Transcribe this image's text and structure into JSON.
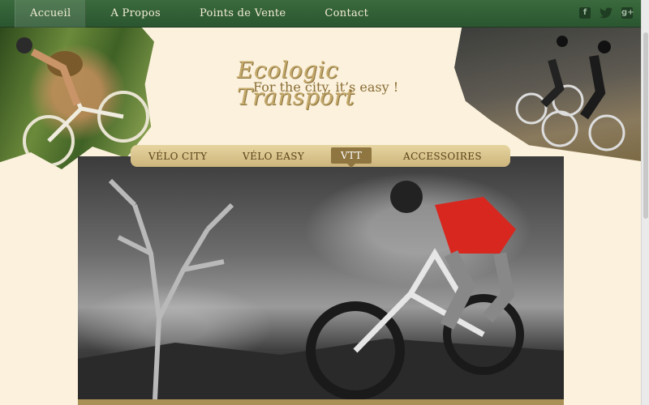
{
  "topnav": {
    "items": [
      {
        "label": "Accueil",
        "active": true
      },
      {
        "label": "A Propos",
        "active": false
      },
      {
        "label": "Points de Vente",
        "active": false
      },
      {
        "label": "Contact",
        "active": false
      }
    ]
  },
  "social": [
    "facebook-icon",
    "twitter-icon",
    "google-plus-icon"
  ],
  "logo": {
    "title": "Ecologic Transport",
    "tagline": "For the city, it’s easy !"
  },
  "categories": [
    {
      "label": "VÉLO CITY",
      "active": false
    },
    {
      "label": "VÉLO EASY",
      "active": false
    },
    {
      "label": "VTT",
      "active": true
    },
    {
      "label": "ACCESSOIRES",
      "active": false
    }
  ],
  "colors": {
    "nav_bg": "#2b5630",
    "page_bg": "#fbf1dc",
    "menu_bg": "#cdb57c",
    "menu_active": "#8f7540",
    "logo_gold": "#c3a86a"
  }
}
